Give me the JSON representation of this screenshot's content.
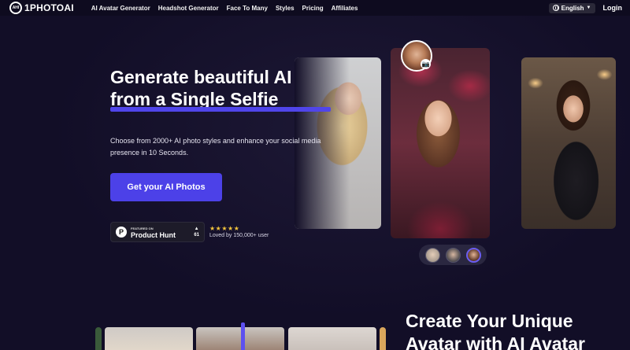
{
  "nav": {
    "logo_mark": "AHI",
    "logo_text": "1PHOTOAI",
    "links": [
      "AI Avatar Generator",
      "Headshot Generator",
      "Face To Many",
      "Styles",
      "Pricing",
      "Affiliates"
    ],
    "language": "English",
    "login": "Login"
  },
  "hero": {
    "headline_line1": "Generate beautiful AI photos",
    "headline_line2": "from a Single Selfie",
    "subtext": "Choose from 2000+ AI photo styles and enhance your social media presence in 10 Seconds.",
    "cta_label": "Get your AI Photos",
    "product_hunt": {
      "featured": "FEATURED ON",
      "name": "Product Hunt",
      "votes": "61"
    },
    "rating": {
      "stars": "★★★★★",
      "text": "Loved by 150,000+ user"
    }
  },
  "section2": {
    "title_line1": "Create Your Unique",
    "title_line2": "Avatar with AI Avatar"
  },
  "colors": {
    "background": "#120e27",
    "accent": "#4c41e8",
    "star": "#f3c43c"
  }
}
